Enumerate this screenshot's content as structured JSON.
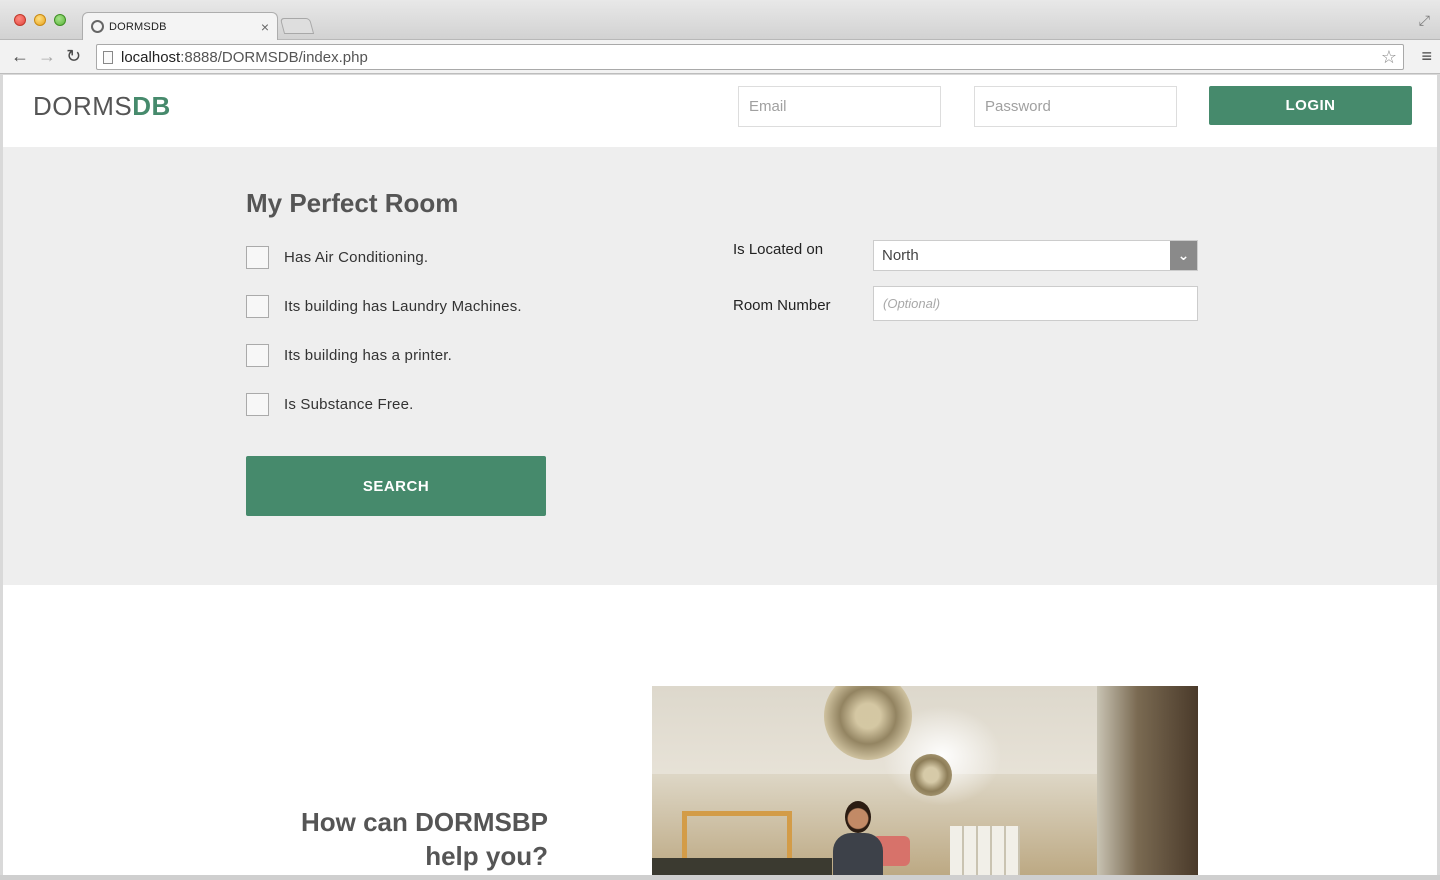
{
  "browser": {
    "tab_title": "DORMSDB",
    "tab_close": "×",
    "url_host": "localhost",
    "url_rest": ":8888/DORMSDB/index.php",
    "icons": {
      "back": "←",
      "forward": "→",
      "reload": "↻",
      "star": "☆",
      "menu": "≡",
      "fullscreen": "⤢"
    }
  },
  "header": {
    "logo_light": "DORMS",
    "logo_bold": "DB",
    "email_placeholder": "Email",
    "password_placeholder": "Password",
    "login_label": "LOGIN"
  },
  "search": {
    "title": "My Perfect Room",
    "checkboxes": [
      {
        "label": "Has Air Conditioning.",
        "checked": false
      },
      {
        "label": "Its building has Laundry Machines.",
        "checked": false
      },
      {
        "label": "Its building has a printer.",
        "checked": false
      },
      {
        "label": "Is Substance Free.",
        "checked": false
      }
    ],
    "search_label": "SEARCH",
    "location_label": "Is Located on",
    "location_value": "North",
    "room_label": "Room Number",
    "room_placeholder": "(Optional)"
  },
  "promo": {
    "heading_line1": "How can DORMSBP",
    "heading_line2": "help you?"
  },
  "colors": {
    "accent": "#468a6c",
    "section_bg": "#eeeeee",
    "text_dark": "#555555"
  }
}
